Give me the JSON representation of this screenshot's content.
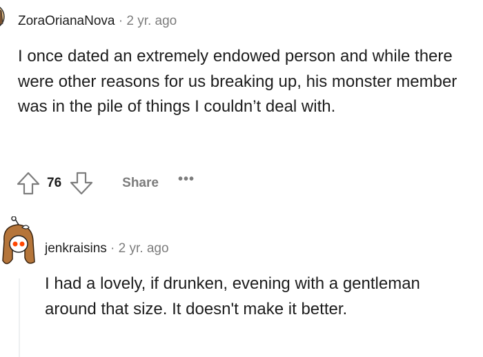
{
  "comments": [
    {
      "username": "ZoraOrianaNova",
      "separator": "·",
      "time": "2 yr. ago",
      "body": "I once dated an extremely endowed person and while there were other reasons for us breaking up, his monster member was in the pile of things I couldn’t deal with.",
      "votes": "76",
      "share_label": "Share",
      "more_label": "•••"
    },
    {
      "username": "jenkraisins",
      "separator": "·",
      "time": "2 yr. ago",
      "body": "I had a lovely, if drunken, evening with a gentleman around that size. It doesn't make it better."
    }
  ],
  "icons": {
    "upvote": "upvote-arrow-icon",
    "downvote": "downvote-arrow-icon",
    "avatar_1": "snoo-avatar",
    "avatar_2": "snoo-avatar-pigtails"
  },
  "colors": {
    "text": "#1c1c1c",
    "meta": "#7c7c7c",
    "snoo_eye": "#ff4500"
  }
}
